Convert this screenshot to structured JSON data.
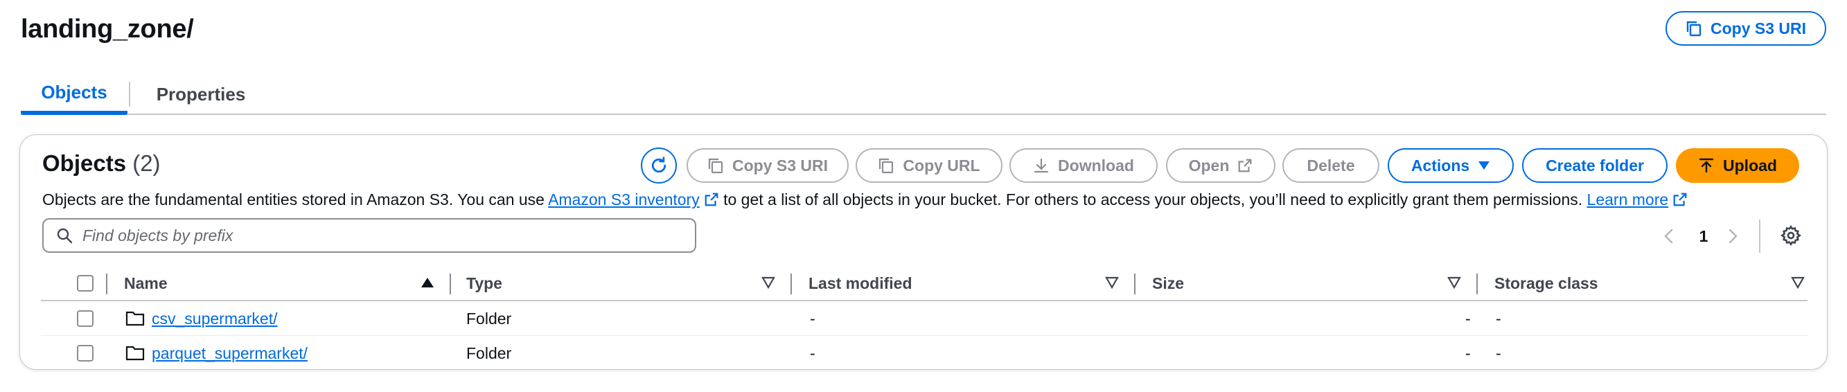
{
  "header": {
    "title": "landing_zone/",
    "copy_s3_uri": "Copy S3 URI"
  },
  "tabs": [
    {
      "label": "Objects",
      "active": true
    },
    {
      "label": "Properties",
      "active": false
    }
  ],
  "objects_panel": {
    "title": "Objects",
    "count": "(2)",
    "toolbar": {
      "copy_s3_uri": "Copy S3 URI",
      "copy_url": "Copy URL",
      "download": "Download",
      "open": "Open",
      "delete": "Delete",
      "actions": "Actions",
      "create_folder": "Create folder",
      "upload": "Upload"
    },
    "description": {
      "before": "Objects are the fundamental entities stored in Amazon S3. You can use",
      "link1": "Amazon S3 inventory",
      "middle": "to get a list of all objects in your bucket. For others to access your objects, you’ll need to explicitly grant them permissions.",
      "link2": "Learn more"
    },
    "search": {
      "placeholder": "Find objects by prefix",
      "value": ""
    },
    "pagination": {
      "current_page": "1"
    },
    "table": {
      "columns": [
        "Name",
        "Type",
        "Last modified",
        "Size",
        "Storage class"
      ],
      "rows": [
        {
          "name": "csv_supermarket/",
          "type": "Folder",
          "last_modified": "-",
          "size": "-",
          "storage_class": "-"
        },
        {
          "name": "parquet_supermarket/",
          "type": "Folder",
          "last_modified": "-",
          "size": "-",
          "storage_class": "-"
        }
      ]
    }
  },
  "colors": {
    "accent": "#006ce0",
    "primary_button": "#ff9900",
    "disabled": "#8c8c94",
    "text": "#0f141a"
  }
}
